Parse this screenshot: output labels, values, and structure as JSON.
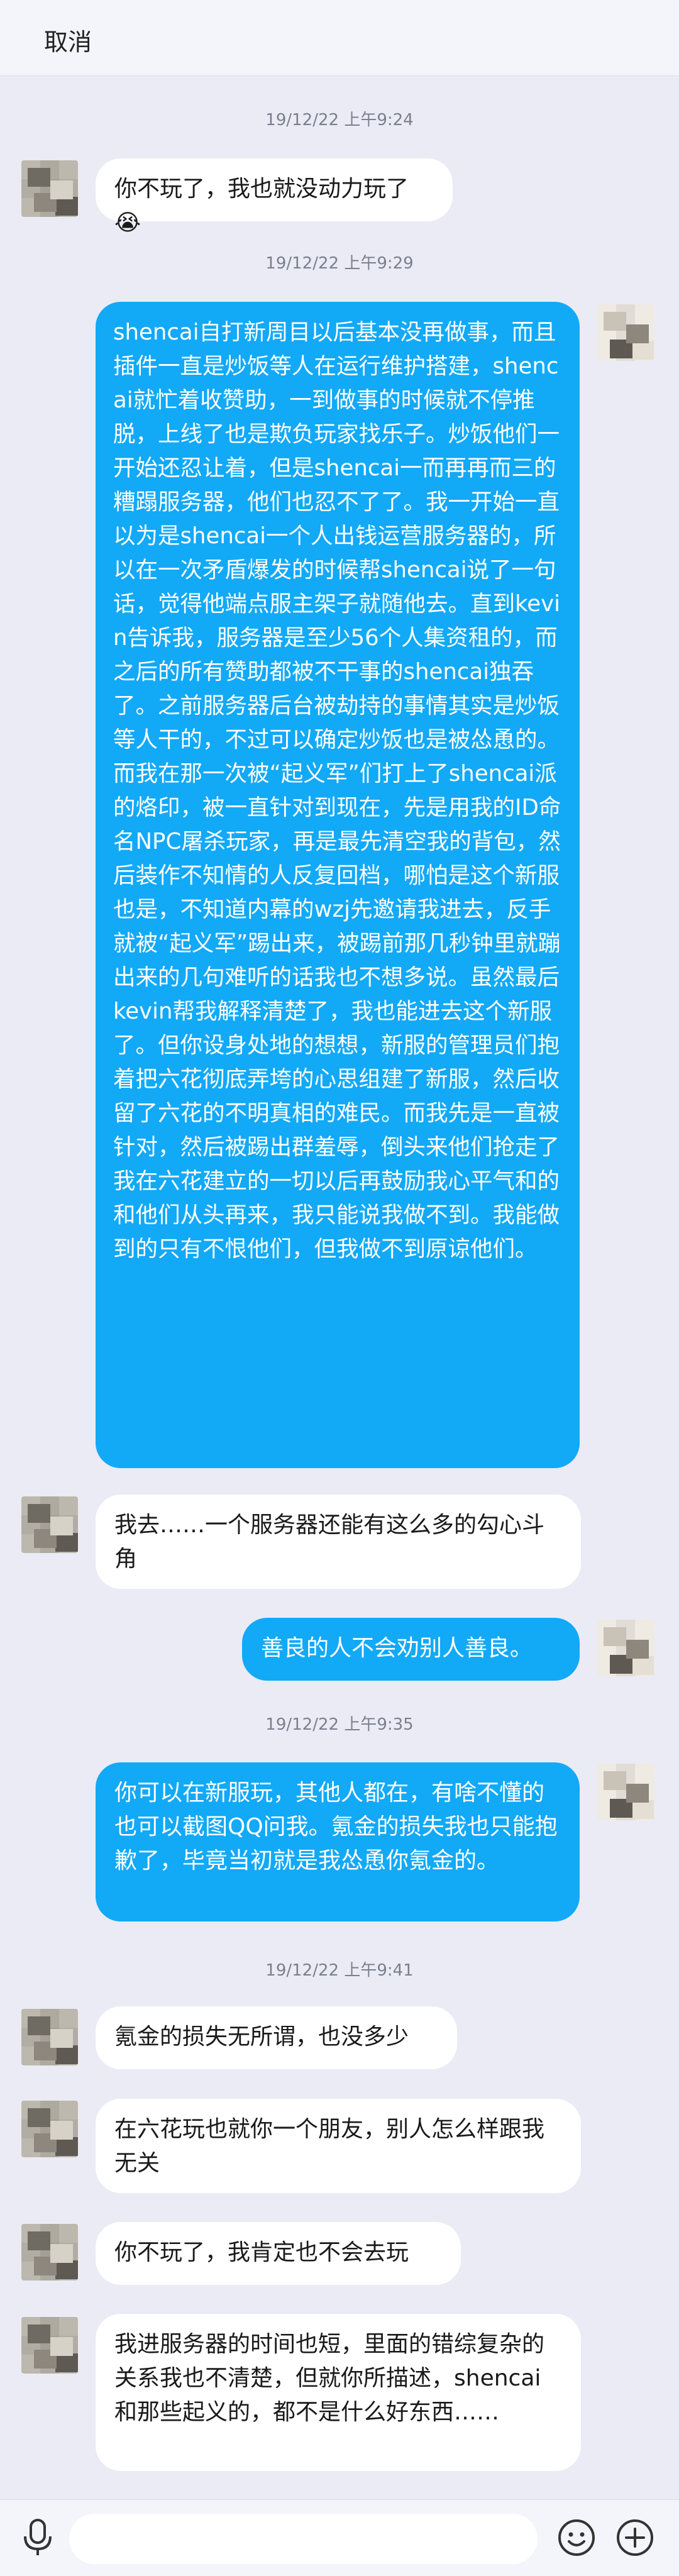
{
  "header": {
    "cancel_label": "取消",
    "contact_name": "",
    "contact_sub": ""
  },
  "colors": {
    "background": "#eaebf4",
    "outgoing_bubble": "#12a9f7",
    "incoming_bubble": "#ffffff"
  },
  "icons": {
    "mic": "microphone-icon",
    "emoji": "emoji-icon",
    "plus": "plus-icon"
  },
  "timestamps": [
    "19/12/22 上午9:24",
    "19/12/22 上午9:29",
    "19/12/22 上午9:35",
    "19/12/22 上午9:41"
  ],
  "messages": [
    {
      "side": "in",
      "text": "你不玩了，我也就没动力玩了😭"
    },
    {
      "side": "out",
      "text": "shencai自打新周目以后基本没再做事，而且插件一直是炒饭等人在运行维护搭建，shencai就忙着收赞助，一到做事的时候就不停推脱，上线了也是欺负玩家找乐子。炒饭他们一开始还忍让着，但是shencai一而再再而三的糟蹋服务器，他们也忍不了了。我一开始一直以为是shencai一个人出钱运营服务器的，所以在一次矛盾爆发的时候帮shencai说了一句话，觉得他端点服主架子就随他去。直到kevin告诉我，服务器是至少56个人集资租的，而之后的所有赞助都被不干事的shencai独吞了。之前服务器后台被劫持的事情其实是炒饭等人干的，不过可以确定炒饭也是被怂恿的。而我在那一次被“起义军”们打上了shencai派的烙印，被一直针对到现在，先是用我的ID命名NPC屠杀玩家，再是最先清空我的背包，然后装作不知情的人反复回档，哪怕是这个新服也是，不知道内幕的wzj先邀请我进去，反手就被“起义军”踢出来，被踢前那几秒钟里就蹦出来的几句难听的话我也不想多说。虽然最后kevin帮我解释清楚了，我也能进去这个新服了。但你设身处地的想想，新服的管理员们抱着把六花彻底弄垮的心思组建了新服，然后收留了六花的不明真相的难民。而我先是一直被针对，然后被踢出群羞辱，倒头来他们抢走了我在六花建立的一切以后再鼓励我心平气和的和他们从头再来，我只能说我做不到。我能做到的只有不恨他们，但我做不到原谅他们。"
    },
    {
      "side": "in",
      "text": "我去……一个服务器还能有这么多的勾心斗角"
    },
    {
      "side": "out",
      "text": "善良的人不会劝别人善良。"
    },
    {
      "side": "out",
      "text": "你可以在新服玩，其他人都在，有啥不懂的也可以截图QQ问我。氪金的损失我也只能抱歉了，毕竟当初就是我怂恿你氪金的。"
    },
    {
      "side": "in",
      "text": "氪金的损失无所谓，也没多少"
    },
    {
      "side": "in",
      "text": "在六花玩也就你一个朋友，别人怎么样跟我无关"
    },
    {
      "side": "in",
      "text": "你不玩了，我肯定也不会去玩"
    },
    {
      "side": "in",
      "text": "我进服务器的时间也短，里面的错综复杂的关系我也不清楚，但就你所描述，shencai和那些起义的，都不是什么好东西……"
    }
  ]
}
